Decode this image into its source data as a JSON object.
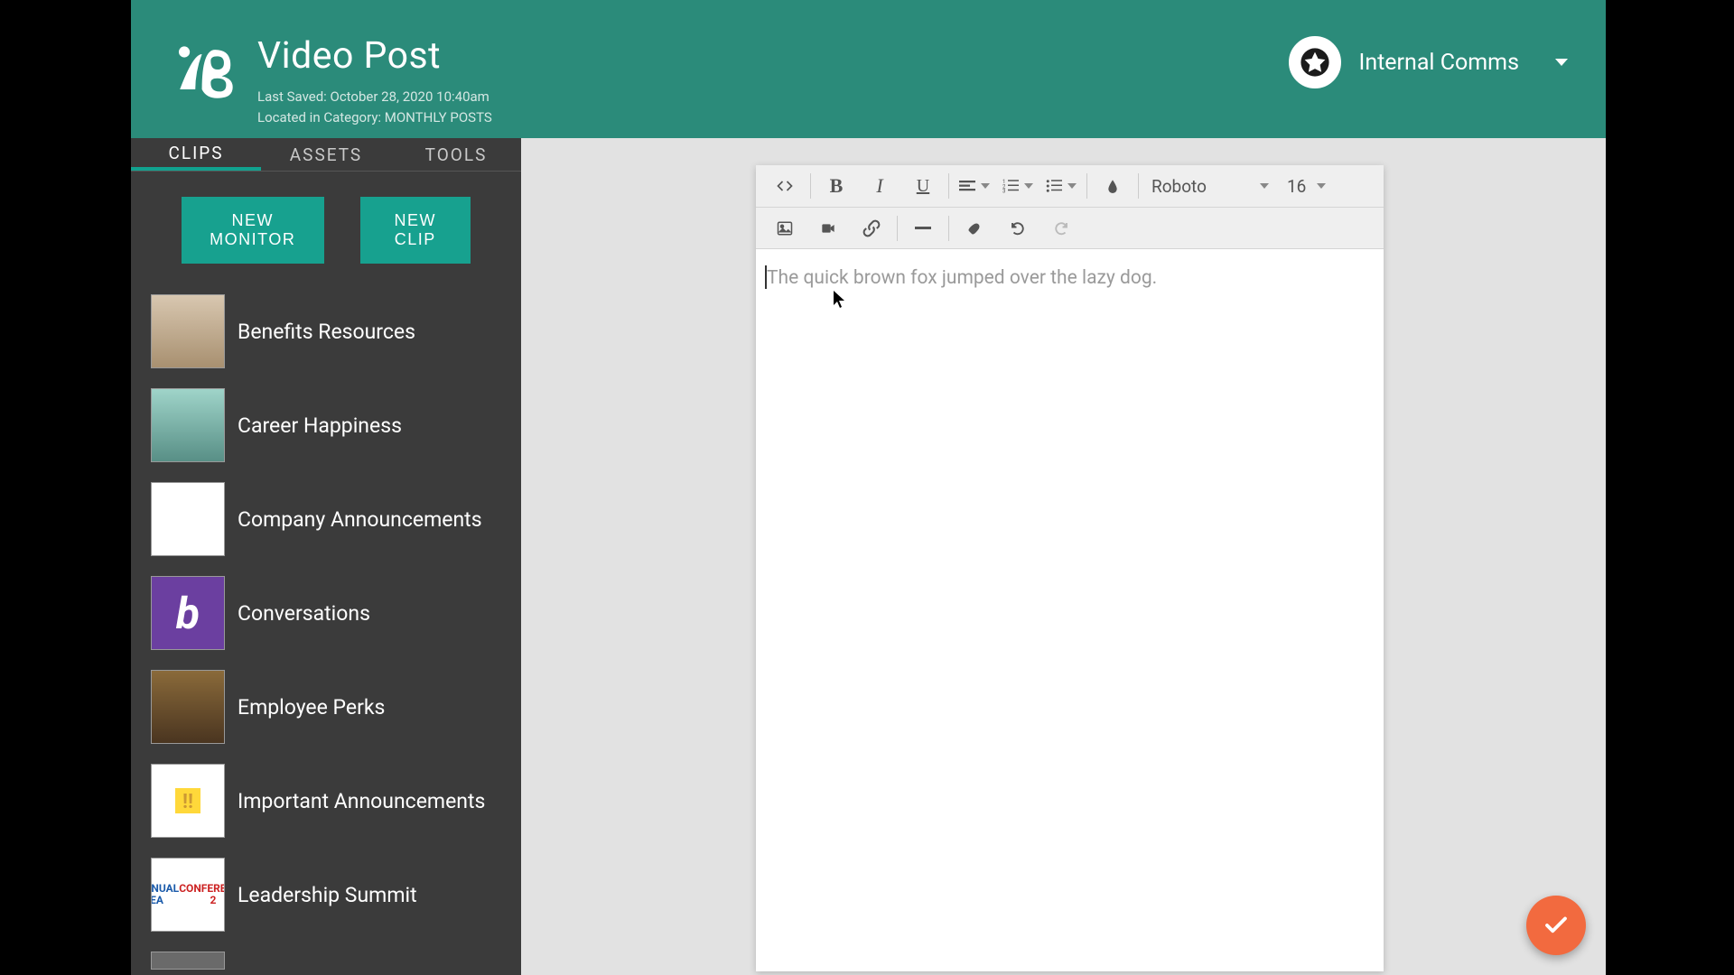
{
  "header": {
    "title": "Video Post",
    "last_saved": "Last Saved: October 28, 2020 10:40am",
    "located_in_prefix": "Located in Category: ",
    "located_in_category": "MONTHLY POSTS",
    "account_label": "Internal Comms"
  },
  "sidebar": {
    "tabs": [
      {
        "label": "CLIPS",
        "active": true
      },
      {
        "label": "ASSETS",
        "active": false
      },
      {
        "label": "TOOLS",
        "active": false
      }
    ],
    "buttons": {
      "new_monitor": "NEW MONITOR",
      "new_clip": "NEW CLIP"
    },
    "clips": [
      {
        "label": "Benefits Resources"
      },
      {
        "label": "Career Happiness"
      },
      {
        "label": "Company Announcements"
      },
      {
        "label": "Conversations"
      },
      {
        "label": "Employee Perks"
      },
      {
        "label": "Important Announcements"
      },
      {
        "label": "Leadership Summit"
      }
    ]
  },
  "editor": {
    "placeholder": "The quick brown fox jumped over the lazy dog.",
    "font": "Roboto",
    "size": "16"
  }
}
